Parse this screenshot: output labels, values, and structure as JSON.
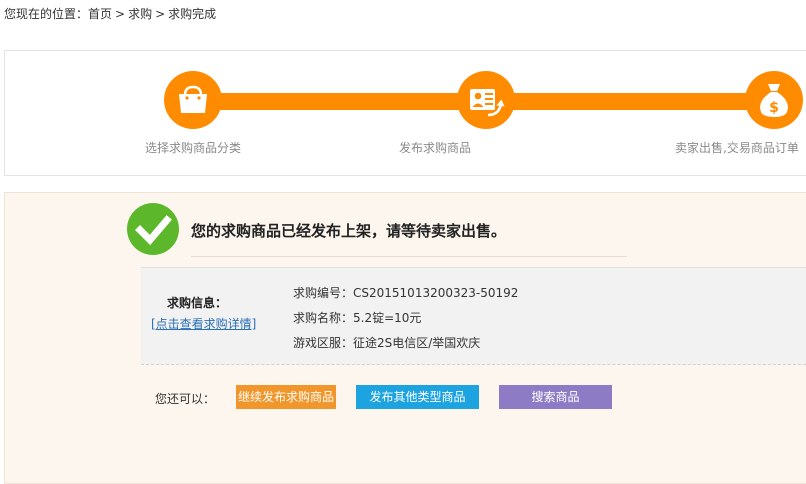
{
  "breadcrumb": {
    "prefix": "您现在的位置：",
    "items": [
      "首页",
      "求购",
      "求购完成"
    ],
    "separator": ">"
  },
  "steps": [
    {
      "label": "选择求购商品分类",
      "icon": "shopping-bag-icon"
    },
    {
      "label": "发布求购商品",
      "icon": "publish-profile-icon"
    },
    {
      "label": "卖家出售,交易商品订单",
      "icon": "money-bag-icon"
    }
  ],
  "colors": {
    "accent": "#ff8c00",
    "success": "#5cb82a",
    "link": "#2a6fb8"
  },
  "result": {
    "message": "您的求购商品已经发布上架，请等待卖家出售。",
    "info_title": "求购信息：",
    "detail_link": "[点击查看求购详情]",
    "rows": [
      {
        "label": "求购编号：",
        "value": "CS20151013200323-50192"
      },
      {
        "label": "求购名称：",
        "value": "5.2锭=10元"
      },
      {
        "label": "游戏区服：",
        "value": "征途2S电信区/举国欢庆"
      }
    ]
  },
  "actions": {
    "prompt": "您还可以：",
    "buttons": [
      {
        "label": "继续发布求购商品",
        "color": "#f0962a"
      },
      {
        "label": "发布其他类型商品",
        "color": "#1ca3e0"
      },
      {
        "label": "搜索商品",
        "color": "#8d7bc6"
      }
    ]
  }
}
